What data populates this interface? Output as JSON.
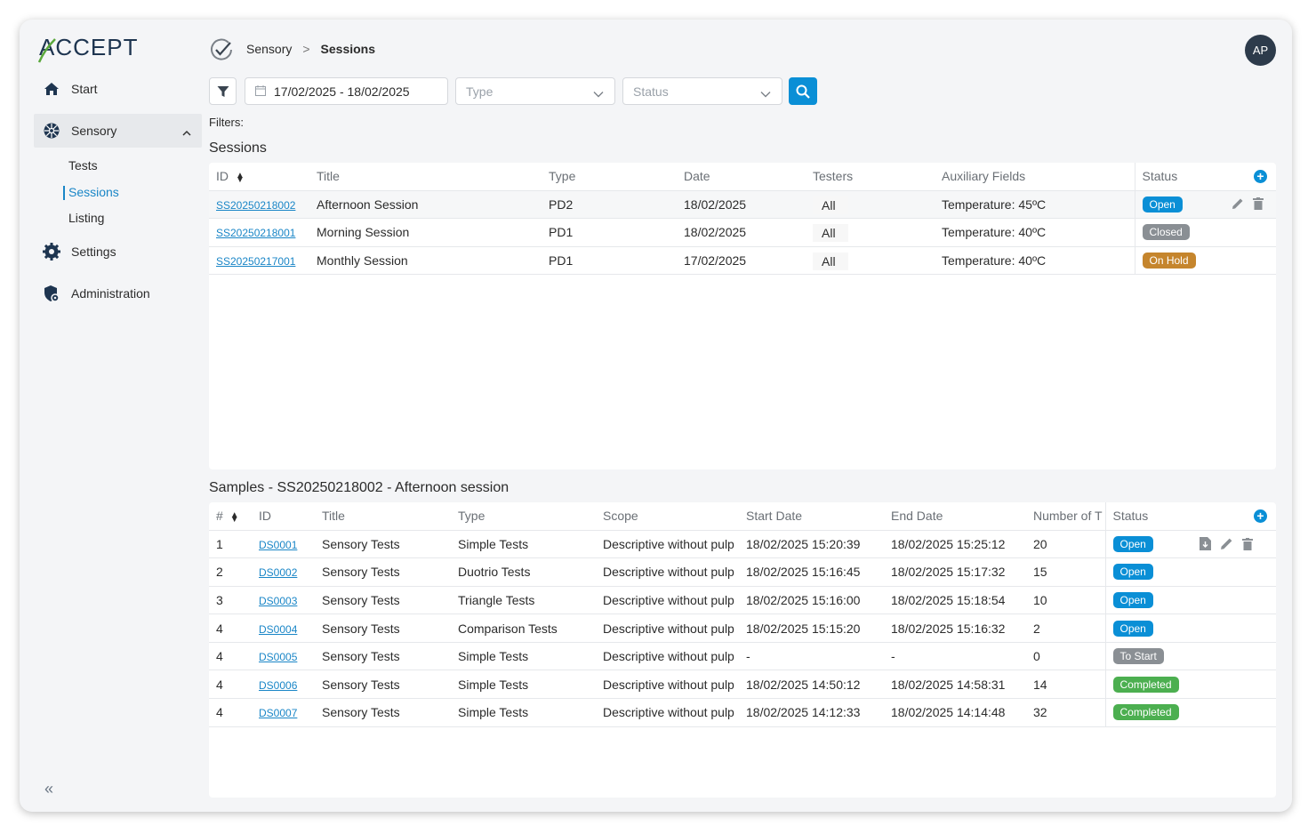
{
  "logo": {
    "text": "ACCEPT"
  },
  "sidebar": {
    "items": [
      {
        "label": "Start",
        "icon": "home-icon"
      },
      {
        "label": "Sensory",
        "icon": "sensory-icon"
      },
      {
        "label": "Settings",
        "icon": "gear-icon"
      },
      {
        "label": "Administration",
        "icon": "admin-shield-icon"
      }
    ],
    "sub_items": [
      {
        "label": "Tests"
      },
      {
        "label": "Sessions"
      },
      {
        "label": "Listing"
      }
    ],
    "collapse_label": "«"
  },
  "breadcrumb": {
    "parent": "Sensory",
    "separator": ">",
    "current": "Sessions"
  },
  "user": {
    "initials": "AP"
  },
  "filters": {
    "date_range": "17/02/2025 - 18/02/2025",
    "type_placeholder": "Type",
    "status_placeholder": "Status",
    "label": "Filters:"
  },
  "sessions": {
    "title": "Sessions",
    "columns": [
      "ID",
      "Title",
      "Type",
      "Date",
      "Testers",
      "Auxiliary Fields",
      "Status"
    ],
    "rows": [
      {
        "id": "SS20250218002",
        "title": "Afternoon Session",
        "type": "PD2",
        "date": "18/02/2025",
        "testers": "All",
        "aux": "Temperature: 45ºC",
        "status": "Open",
        "status_kind": "open"
      },
      {
        "id": "SS20250218001",
        "title": "Morning Session",
        "type": "PD1",
        "date": "18/02/2025",
        "testers": "All",
        "aux": "Temperature: 40ºC",
        "status": "Closed",
        "status_kind": "closed"
      },
      {
        "id": "SS20250217001",
        "title": "Monthly Session",
        "type": "PD1",
        "date": "17/02/2025",
        "testers": "All",
        "aux": "Temperature: 40ºC",
        "status": "On Hold",
        "status_kind": "hold"
      }
    ]
  },
  "samples": {
    "title": "Samples - SS20250218002 - Afternoon session",
    "columns": [
      "#",
      "ID",
      "Title",
      "Type",
      "Scope",
      "Start Date",
      "End Date",
      "Number of T",
      "Status"
    ],
    "rows": [
      {
        "num": "1",
        "id": "DS0001",
        "title": "Sensory Tests",
        "type": "Simple Tests",
        "scope": "Descriptive without pulp",
        "start": "18/02/2025 15:20:39",
        "end": "18/02/2025 15:25:12",
        "count": "20",
        "status": "Open",
        "status_kind": "open"
      },
      {
        "num": "2",
        "id": "DS0002",
        "title": "Sensory Tests",
        "type": "Duotrio Tests",
        "scope": "Descriptive without pulp",
        "start": "18/02/2025 15:16:45",
        "end": "18/02/2025 15:17:32",
        "count": "15",
        "status": "Open",
        "status_kind": "open"
      },
      {
        "num": "3",
        "id": "DS0003",
        "title": "Sensory Tests",
        "type": "Triangle Tests",
        "scope": "Descriptive without pulp",
        "start": "18/02/2025 15:16:00",
        "end": "18/02/2025 15:18:54",
        "count": "10",
        "status": "Open",
        "status_kind": "open"
      },
      {
        "num": "4",
        "id": "DS0004",
        "title": "Sensory Tests",
        "type": "Comparison Tests",
        "scope": "Descriptive without pulp",
        "start": "18/02/2025 15:15:20",
        "end": "18/02/2025 15:16:32",
        "count": "2",
        "status": "Open",
        "status_kind": "open"
      },
      {
        "num": "4",
        "id": "DS0005",
        "title": "Sensory Tests",
        "type": "Simple Tests",
        "scope": "Descriptive without pulp",
        "start": "-",
        "end": "-",
        "count": "0",
        "status": "To Start",
        "status_kind": "tostart"
      },
      {
        "num": "4",
        "id": "DS0006",
        "title": "Sensory Tests",
        "type": "Simple Tests",
        "scope": "Descriptive without pulp",
        "start": "18/02/2025 14:50:12",
        "end": "18/02/2025 14:58:31",
        "count": "14",
        "status": "Completed",
        "status_kind": "completed"
      },
      {
        "num": "4",
        "id": "DS0007",
        "title": "Sensory Tests",
        "type": "Simple Tests",
        "scope": "Descriptive without pulp",
        "start": "18/02/2025 14:12:33",
        "end": "18/02/2025 14:14:48",
        "count": "32",
        "status": "Completed",
        "status_kind": "completed"
      }
    ]
  },
  "colors": {
    "accent": "#0a8fd6",
    "link": "#1a86c7",
    "avatar_bg": "#2d3b4b"
  }
}
